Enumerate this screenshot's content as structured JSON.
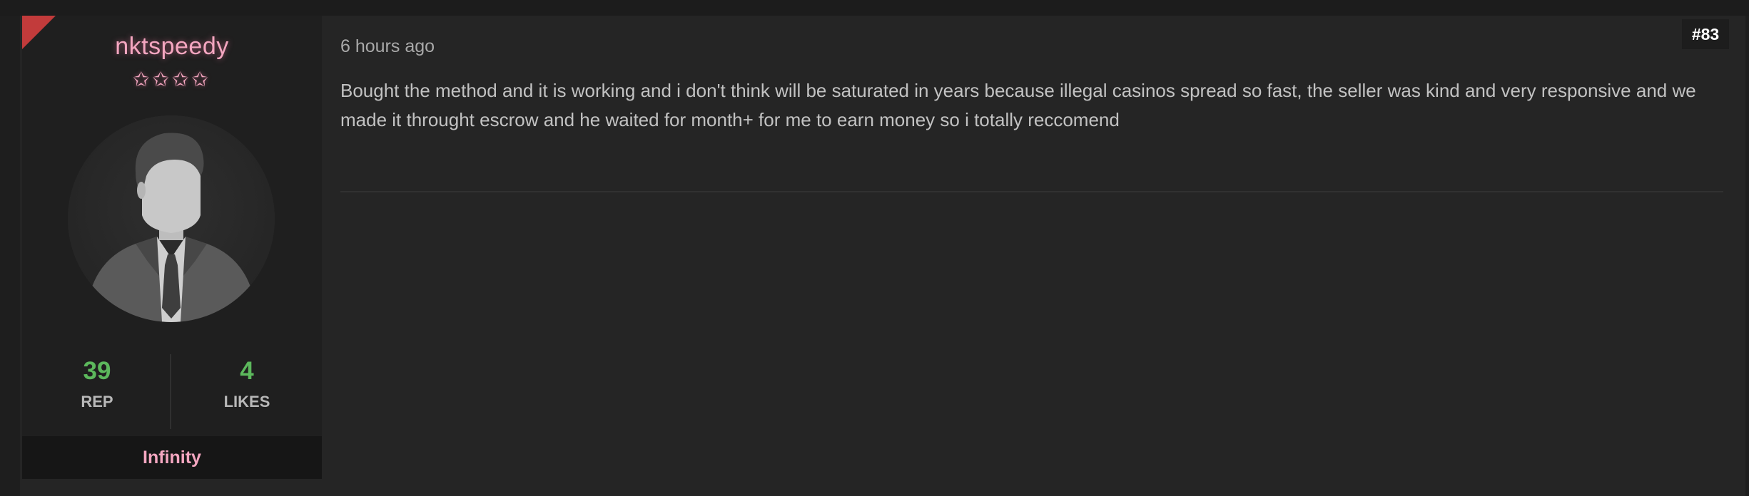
{
  "post": {
    "number": "#83",
    "timestamp": "6 hours ago",
    "message": "Bought the method and it is working and i don't think will be saturated in years because illegal casinos spread so fast, the seller was kind and very responsive and we made it throught escrow and he waited for month+ for me to earn money so i totally reccomend"
  },
  "author": {
    "username": "nktspeedy",
    "stars": "✩✩✩✩",
    "usergroup": "Infinity",
    "rep_value": "39",
    "rep_label": "REP",
    "likes_value": "4",
    "likes_label": "LIKES"
  },
  "colors": {
    "username": "#f4a6c0",
    "stat_value": "#5cb85c",
    "corner_flag": "#c23b3b",
    "background": "#252525"
  },
  "icons": {
    "corner": "corner-flag-icon",
    "avatar": "default-avatar-icon",
    "stars": "star-rating-icon"
  }
}
